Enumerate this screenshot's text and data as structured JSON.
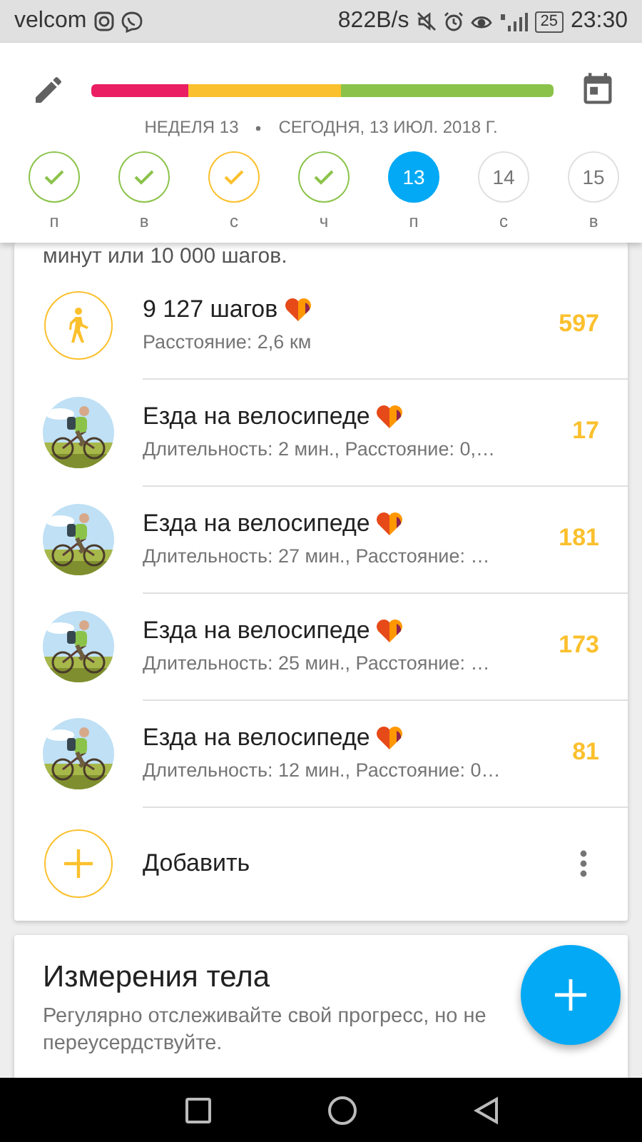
{
  "status_bar": {
    "carrier": "velcom",
    "speed": "822B/s",
    "battery": "25",
    "time": "23:30"
  },
  "header": {
    "progress": [
      {
        "color": "#e91e63"
      },
      {
        "color": "#fbc02d"
      },
      {
        "color": "#8bc34a"
      }
    ],
    "week": "НЕДЕЛЯ 13",
    "date": "СЕГОДНЯ, 13 ИЮЛ. 2018 Г.",
    "days": [
      {
        "kind": "done",
        "label": "п",
        "selected": false
      },
      {
        "kind": "done",
        "label": "в",
        "selected": false
      },
      {
        "kind": "partial",
        "label": "с",
        "selected": false
      },
      {
        "kind": "done",
        "label": "ч",
        "selected": false
      },
      {
        "kind": "today",
        "number": "13",
        "label": "п",
        "selected": true
      },
      {
        "kind": "future",
        "number": "14",
        "label": "с",
        "selected": false
      },
      {
        "kind": "future",
        "number": "15",
        "label": "в",
        "selected": false
      }
    ]
  },
  "activity": {
    "partial_text": "минут или 10 000 шагов.",
    "items": [
      {
        "kind": "steps",
        "title": "9 127 шагов",
        "subtitle": "Расстояние: 2,6 км",
        "value": "597"
      },
      {
        "kind": "bike",
        "title": "Езда на велосипеде",
        "subtitle": "Длительность: 2 мин., Расстояние: 0,…",
        "value": "17"
      },
      {
        "kind": "bike",
        "title": "Езда на велосипеде",
        "subtitle": "Длительность: 27 мин., Расстояние: …",
        "value": "181"
      },
      {
        "kind": "bike",
        "title": "Езда на велосипеде",
        "subtitle": "Длительность: 25 мин., Расстояние: …",
        "value": "173"
      },
      {
        "kind": "bike",
        "title": "Езда на велосипеде",
        "subtitle": "Длительность: 12 мин., Расстояние: 0…",
        "value": "81"
      }
    ],
    "add": "Добавить"
  },
  "body": {
    "title": "Измерения тела",
    "text": "Регулярно отслеживайте свой прогресс, но не переусердствуйте."
  }
}
